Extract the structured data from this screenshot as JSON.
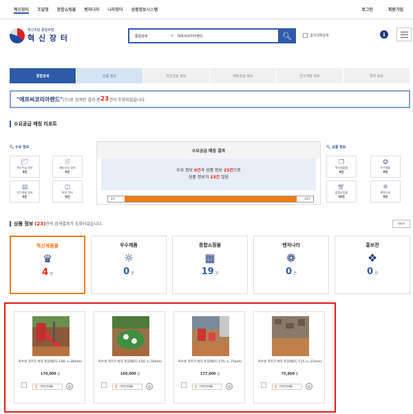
{
  "topnav": {
    "left": [
      "혁신장터",
      "조달청",
      "종합쇼핑몰",
      "벤처나라",
      "나라장터",
      "상품정보시스템"
    ],
    "right": [
      "로그인",
      "회원가입"
    ]
  },
  "logo": {
    "small": "혁신조달 종합포털",
    "big": "혁 신 장 터"
  },
  "search": {
    "select_label": "통합검색",
    "value": "에프씨코리아랜드",
    "search_icon": "search-icon"
  },
  "checkbox_label": "결과내재검색",
  "tabs": [
    "통합검색",
    "상품 정보",
    "혁신조달 정보",
    "예정조달 정보",
    "연구개발 정보",
    "특허 정보"
  ],
  "result": {
    "query": "\"에프씨코리아랜드\"",
    "prefix": "(으)로 검색한 결과 총 ",
    "count": "23",
    "suffix": "건이 조회되었습니다."
  },
  "supply_title": "수요공급 매칭 리포트",
  "demand_title": "수요 정보",
  "product_info_title": "상품 정보",
  "demand_items": [
    {
      "label": "혁신수요 정보",
      "count": "0건"
    },
    {
      "label": "예타조달 정보",
      "count": "0건"
    },
    {
      "label": "연구개발 정보",
      "count": "0건"
    },
    {
      "label": "특허 정보",
      "count": "0건"
    }
  ],
  "product_items": [
    {
      "label": "혁신제품몰",
      "count": "4건"
    },
    {
      "label": "우수제품",
      "count": "0건"
    },
    {
      "label": "종합쇼핑몰",
      "count": "19건"
    },
    {
      "label": "벤처나라",
      "count": "0건"
    }
  ],
  "matching": {
    "title": "수요공급 매칭 결과",
    "line1_a": "수요 정보 ",
    "line1_b": "0건",
    "line1_c": "과 상품 정보 ",
    "line1_d": "23건",
    "line1_e": "으로",
    "line2_a": "상품 정보가 ",
    "line2_b": "23건",
    "line2_c": " 많음",
    "bar_left": "0건",
    "bar_right": "23건",
    "bar_fraction": 0.9
  },
  "product_section": {
    "title": "상품 정보",
    "count": "(23)",
    "suffix": "건의 검색결과가 조회되었습니다.",
    "more": "더보기"
  },
  "categories": [
    {
      "name": "혁신제품몰",
      "count": "4",
      "unit": "건",
      "icon": "♛"
    },
    {
      "name": "우수제품",
      "count": "0",
      "unit": "건",
      "icon": "☼"
    },
    {
      "name": "종합쇼핑몰",
      "count": "19",
      "unit": "건",
      "icon": "▦"
    },
    {
      "name": "벤처나라",
      "count": "0",
      "unit": "건",
      "icon": "❁"
    },
    {
      "name": "홍보전",
      "count": "0",
      "unit": "건",
      "icon": "❖"
    }
  ],
  "products": [
    {
      "name": "투수성 코르크 바닥 포장재(FC-C80, t=80mm)",
      "price": "170,000",
      "unit": "원",
      "badge": "기타안전제품"
    },
    {
      "name": "투수성 코르크 바닥 포장재(FC-C50, t=50mm)",
      "price": "160,000",
      "unit": "원",
      "badge": "기타안전제품"
    },
    {
      "name": "투수성 코르크 바닥 포장재(FC-C75, t=75mm)",
      "price": "177,000",
      "unit": "원",
      "badge": "기타안전제품"
    },
    {
      "name": "투수성 코르크 바닥 포장재(FC-C15, t=15mm)",
      "price": "75,960",
      "unit": "원",
      "badge": "기타안전제품"
    }
  ]
}
